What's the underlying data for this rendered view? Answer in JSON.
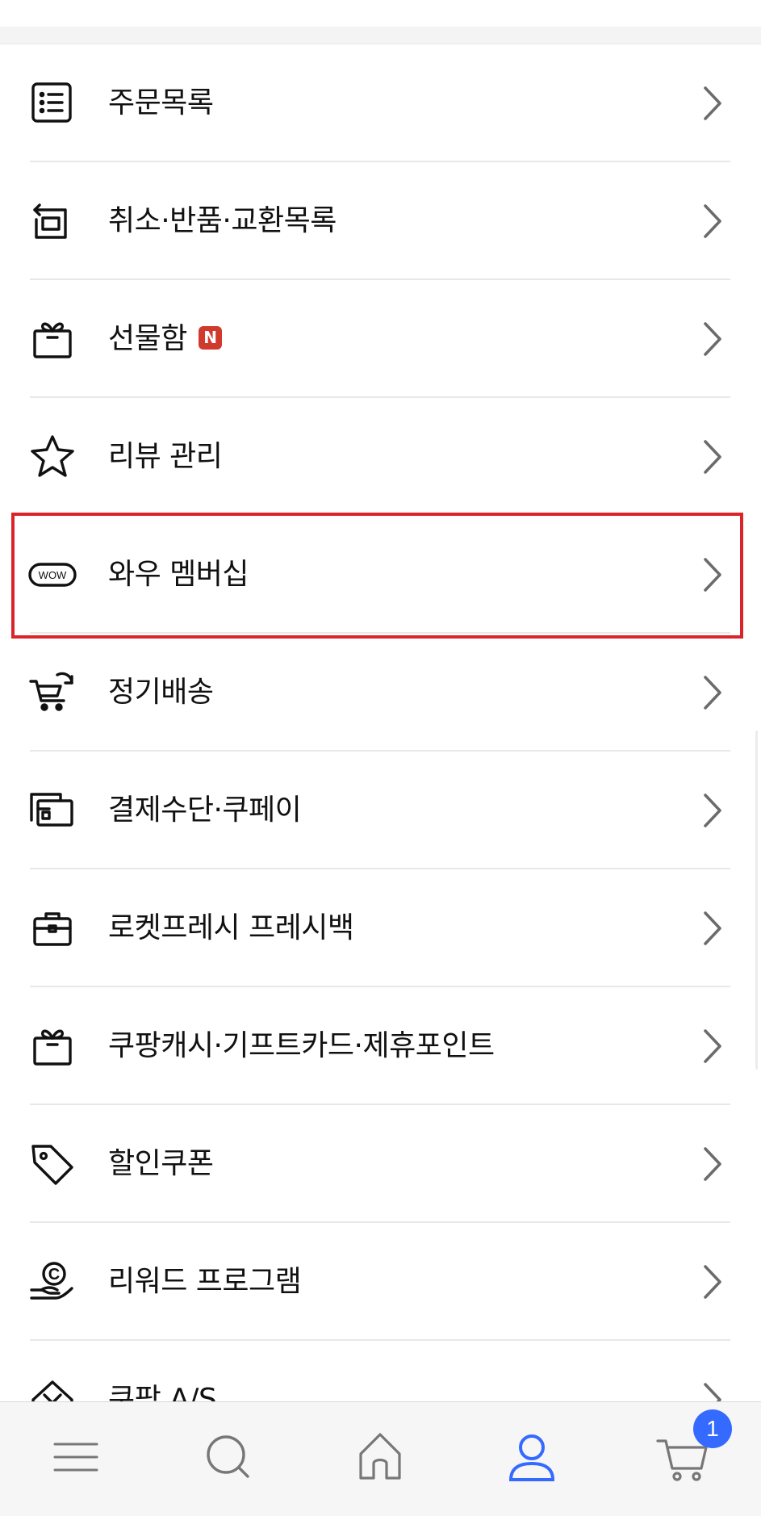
{
  "menu": {
    "items": [
      {
        "label": "주문목록",
        "icon": "order-list-icon"
      },
      {
        "label": "취소·반품·교환목록",
        "icon": "return-box-icon"
      },
      {
        "label": "선물함",
        "icon": "gift-box-icon",
        "badge": "N"
      },
      {
        "label": "리뷰 관리",
        "icon": "star-icon"
      },
      {
        "label": "와우 멤버십",
        "icon": "wow-badge-icon",
        "icon_text": "WOW"
      },
      {
        "label": "정기배송",
        "icon": "subscription-cart-icon"
      },
      {
        "label": "결제수단·쿠페이",
        "icon": "wallet-card-icon"
      },
      {
        "label": "로켓프레시 프레시백",
        "icon": "fresh-bag-icon"
      },
      {
        "label": "쿠팡캐시·기프트카드·제휴포인트",
        "icon": "gift-card-icon"
      },
      {
        "label": "할인쿠폰",
        "icon": "tag-icon"
      },
      {
        "label": "리워드 프로그램",
        "icon": "reward-hand-coin-icon",
        "icon_text": "C"
      },
      {
        "label": "쿠팡 A/S",
        "icon": "service-icon"
      }
    ]
  },
  "tabbar": {
    "items": [
      {
        "name": "menu",
        "icon": "hamburger-menu-icon"
      },
      {
        "name": "search",
        "icon": "search-icon"
      },
      {
        "name": "home",
        "icon": "home-icon"
      },
      {
        "name": "my-coupang",
        "icon": "user-icon",
        "active": true
      },
      {
        "name": "cart",
        "icon": "cart-icon"
      }
    ],
    "cart_count": "1"
  },
  "colors": {
    "accent": "#346aff",
    "badge_red": "#cf3a2c",
    "highlight": "#d9252a",
    "text": "#111111",
    "chevron": "#6b6b6b"
  }
}
